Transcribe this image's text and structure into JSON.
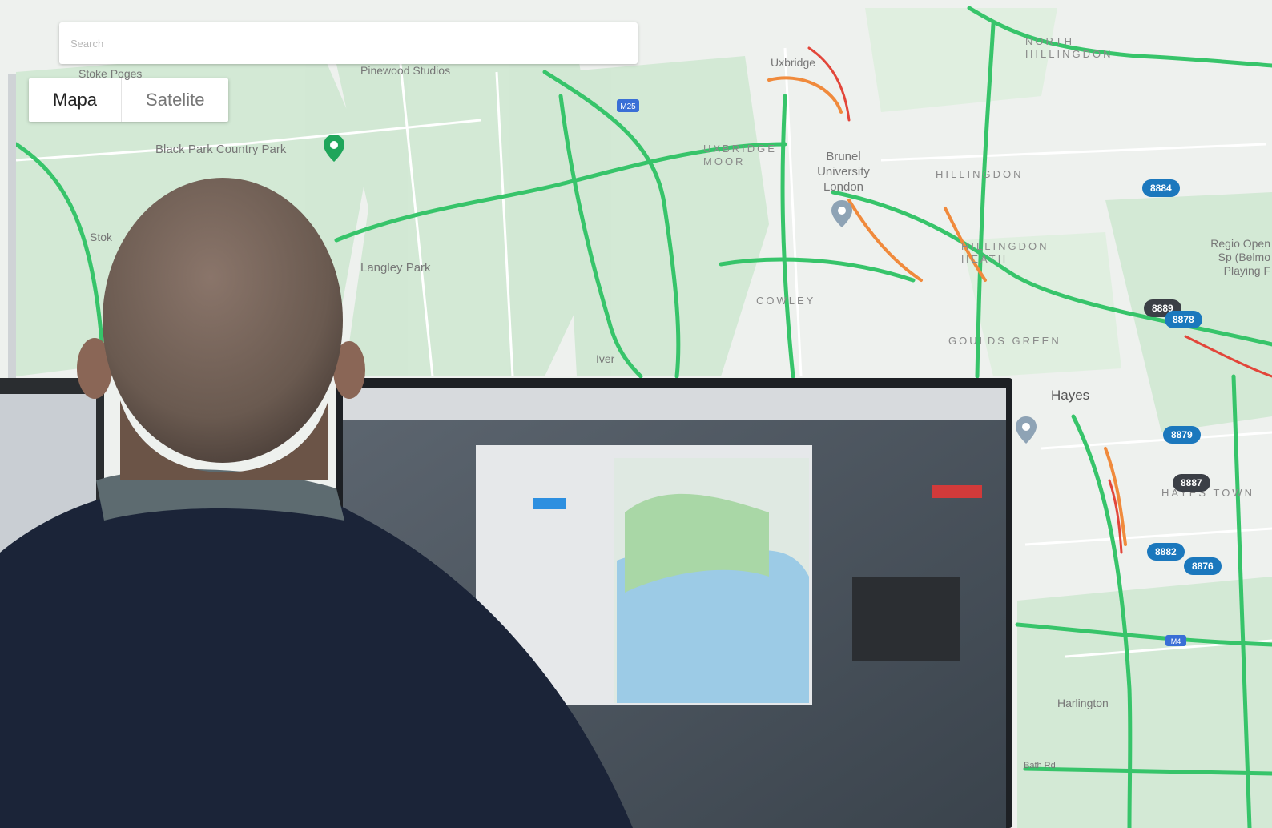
{
  "search": {
    "placeholder": "Search"
  },
  "map_type": {
    "active_label": "Mapa",
    "inactive_label": "Satelite"
  },
  "colors": {
    "road_green": "#37c46a",
    "road_orange": "#f08a3c",
    "road_red": "#e2463a",
    "badge_blue": "#1b78bd",
    "badge_dark": "#3b3f46"
  },
  "labels": {
    "north_hillingdon": "NORTH HILLINGDON",
    "uxbridge": "Uxbridge",
    "uxbridge_moor": "UXBRIDGE MOOR",
    "brunel": "Brunel University London",
    "hillingdon": "HILLINGDON",
    "hillingdon_heath": "HILLINGDON HEATH",
    "cowley": "COWLEY",
    "goulds_green": "GOULDS GREEN",
    "hayes": "Hayes",
    "harlington": "Harlington",
    "langley_park": "Langley Park",
    "black_park": "Black Park Country Park",
    "pinewood": "Pinewood Studios",
    "stoke_poges": "Stoke Poges",
    "stoke": "Stok",
    "iver": "Iver",
    "regional_park": "Regio Open Sp (Belmo Playing F",
    "hayes_town": "HAYES TOWN",
    "m25": "M25",
    "m4": "M4",
    "bath_rd": "Bath Rd"
  },
  "vehicles": [
    {
      "id": "8884",
      "style": "blue"
    },
    {
      "id": "8889",
      "style": "dark"
    },
    {
      "id": "8878",
      "style": "blue"
    },
    {
      "id": "8879",
      "style": "blue"
    },
    {
      "id": "8887",
      "style": "dark"
    },
    {
      "id": "8882",
      "style": "blue"
    },
    {
      "id": "8876",
      "style": "blue"
    }
  ]
}
